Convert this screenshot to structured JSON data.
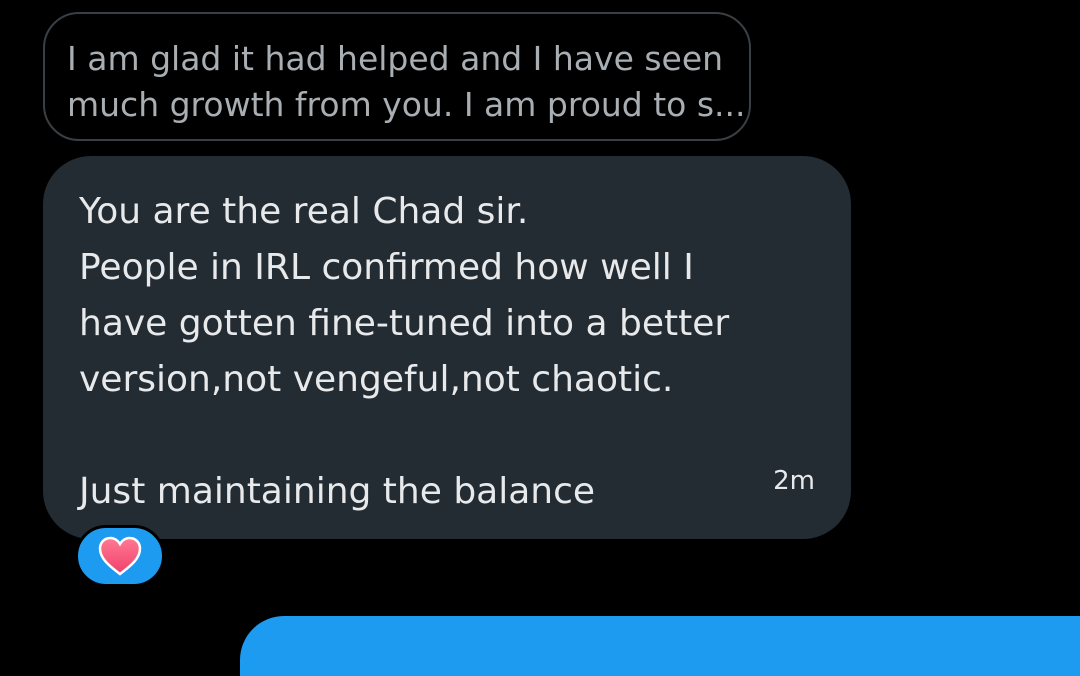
{
  "conversation": {
    "quoted_message": {
      "lines": [
        "I am glad it had helped and I have seen",
        "much growth from you. I am proud to s..."
      ]
    },
    "message": {
      "lines": [
        "You are the real Chad sir.",
        "People in IRL confirmed how well I",
        "have gotten fine-tuned into a better",
        "version,not vengeful,not chaotic.",
        "",
        "Just maintaining the balance"
      ],
      "timestamp": "2m",
      "reaction": {
        "icon": "heart-icon",
        "color": "#ff5a7a",
        "pill_color": "#1d9bf0"
      }
    }
  }
}
